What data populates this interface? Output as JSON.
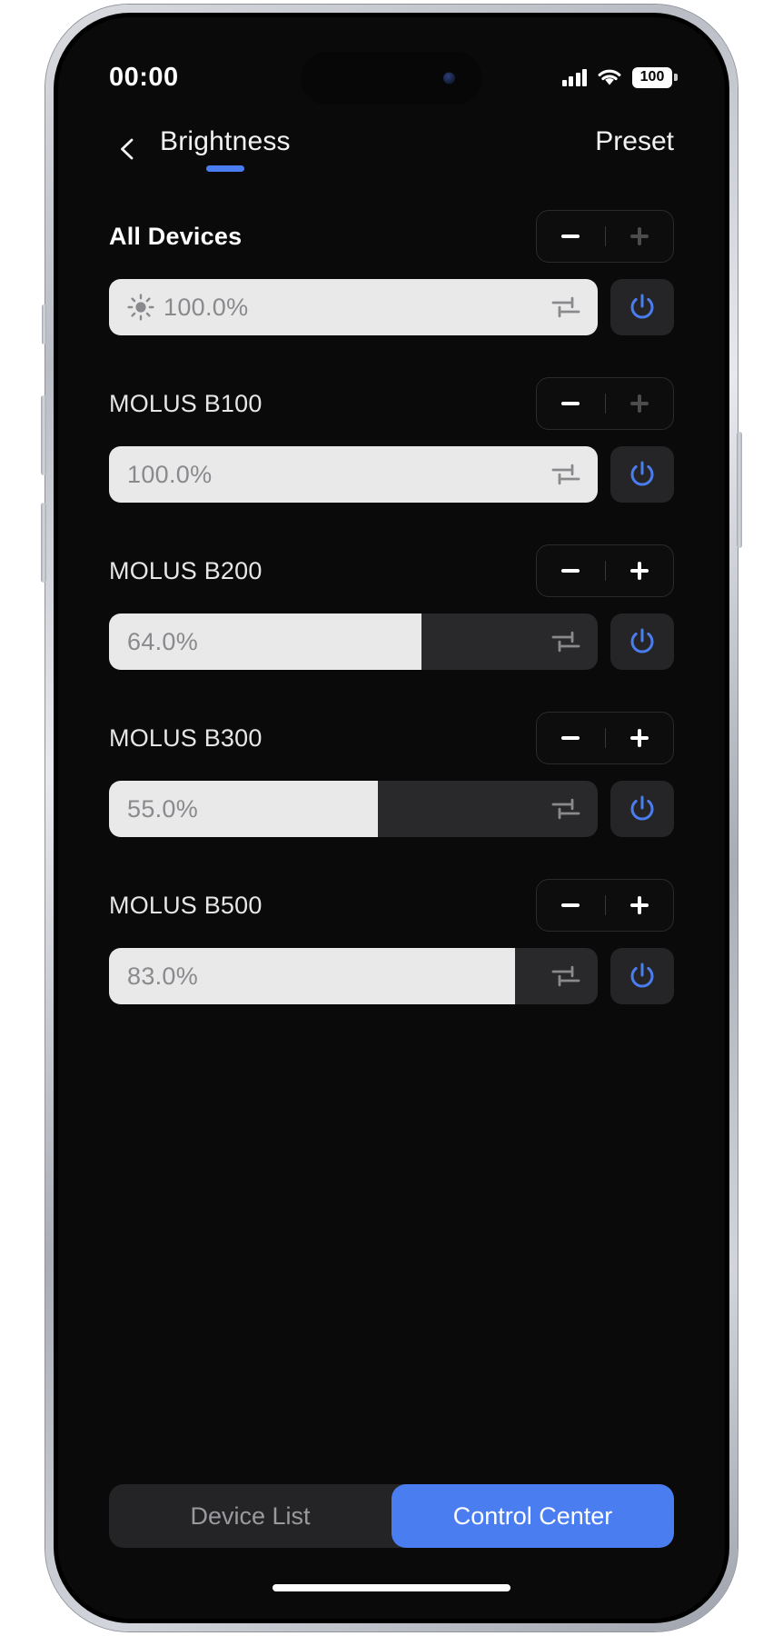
{
  "status_bar": {
    "time": "00:00",
    "signal_icon": "cellular-bars-icon",
    "wifi_icon": "wifi-icon",
    "battery_level": "100"
  },
  "header": {
    "back_icon": "chevron-left-icon",
    "title": "Brightness",
    "action_label": "Preset",
    "accent_color": "#4a7ef0"
  },
  "devices": [
    {
      "name": "All Devices",
      "value_label": "100.0%",
      "fill_percent": 100,
      "has_sun_icon": true,
      "minus_enabled": true,
      "plus_enabled": false,
      "tune_icon": "tune-sliders-icon",
      "power_icon": "power-icon"
    },
    {
      "name": "MOLUS B100",
      "value_label": "100.0%",
      "fill_percent": 100,
      "has_sun_icon": false,
      "minus_enabled": true,
      "plus_enabled": false,
      "tune_icon": "tune-sliders-icon",
      "power_icon": "power-icon"
    },
    {
      "name": "MOLUS B200",
      "value_label": "64.0%",
      "fill_percent": 64,
      "has_sun_icon": false,
      "minus_enabled": true,
      "plus_enabled": true,
      "tune_icon": "tune-sliders-icon",
      "power_icon": "power-icon"
    },
    {
      "name": "MOLUS B300",
      "value_label": "55.0%",
      "fill_percent": 55,
      "has_sun_icon": false,
      "minus_enabled": true,
      "plus_enabled": true,
      "tune_icon": "tune-sliders-icon",
      "power_icon": "power-icon"
    },
    {
      "name": "MOLUS B500",
      "value_label": "83.0%",
      "fill_percent": 83,
      "has_sun_icon": false,
      "minus_enabled": true,
      "plus_enabled": true,
      "tune_icon": "tune-sliders-icon",
      "power_icon": "power-icon"
    }
  ],
  "tabbar": {
    "tabs": [
      {
        "label": "Device List",
        "active": false
      },
      {
        "label": "Control Center",
        "active": true
      }
    ],
    "active_color": "#4a7ef0"
  }
}
